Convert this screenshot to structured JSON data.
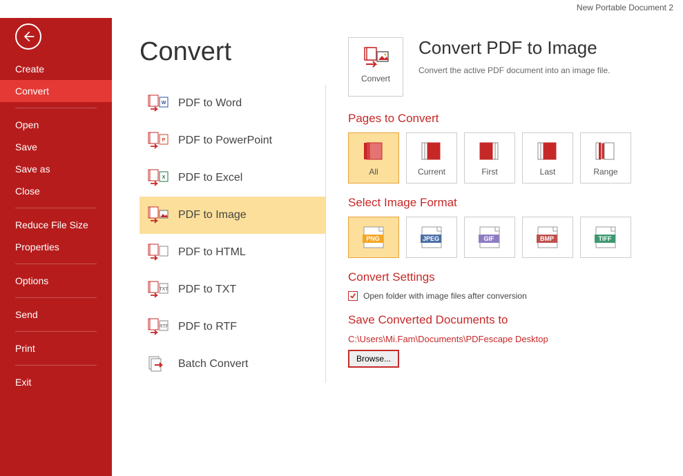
{
  "header": {
    "document_title": "New Portable Document 2"
  },
  "sidebar": {
    "items": [
      {
        "label": "Create"
      },
      {
        "label": "Convert",
        "active": true
      },
      {
        "label": "Open"
      },
      {
        "label": "Save"
      },
      {
        "label": "Save as"
      },
      {
        "label": "Close"
      },
      {
        "label": "Reduce File Size"
      },
      {
        "label": "Properties"
      },
      {
        "label": "Options"
      },
      {
        "label": "Send"
      },
      {
        "label": "Print"
      },
      {
        "label": "Exit"
      }
    ]
  },
  "main": {
    "title": "Convert",
    "convert_options": [
      {
        "label": "PDF to Word",
        "tag": "W",
        "tag_color": "#2B579A"
      },
      {
        "label": "PDF to PowerPoint",
        "tag": "P",
        "tag_color": "#D24726"
      },
      {
        "label": "PDF to Excel",
        "tag": "X",
        "tag_color": "#217346"
      },
      {
        "label": "PDF to Image",
        "tag": "IMG",
        "tag_color": "#C62828",
        "selected": true
      },
      {
        "label": "PDF to HTML",
        "tag": "</>",
        "tag_color": "#888"
      },
      {
        "label": "PDF to TXT",
        "tag": "TXT",
        "tag_color": "#888"
      },
      {
        "label": "PDF to RTF",
        "tag": "RTF",
        "tag_color": "#888"
      },
      {
        "label": "Batch Convert",
        "tag": "BATCH",
        "tag_color": "#888"
      }
    ],
    "hero": {
      "action_label": "Convert",
      "title": "Convert PDF to Image",
      "desc": "Convert the active PDF document into an image file."
    },
    "pages_section_title": "Pages to Convert",
    "page_options": [
      {
        "label": "All",
        "selected": true
      },
      {
        "label": "Current"
      },
      {
        "label": "First"
      },
      {
        "label": "Last"
      },
      {
        "label": "Range"
      }
    ],
    "format_section_title": "Select Image Format",
    "formats": [
      {
        "label": "PNG",
        "color": "#F5A623",
        "selected": true
      },
      {
        "label": "JPEG",
        "color": "#4A6FA5"
      },
      {
        "label": "GIF",
        "color": "#8E7CC3"
      },
      {
        "label": "BMP",
        "color": "#C0504D"
      },
      {
        "label": "TIFF",
        "color": "#3D9970"
      }
    ],
    "settings_section_title": "Convert Settings",
    "checkbox_label": "Open folder with image files after conversion",
    "checkbox_checked": true,
    "save_section_title": "Save Converted Documents to",
    "save_path": "C:\\Users\\Mi.Fam\\Documents\\PDFescape Desktop",
    "browse_label": "Browse..."
  }
}
